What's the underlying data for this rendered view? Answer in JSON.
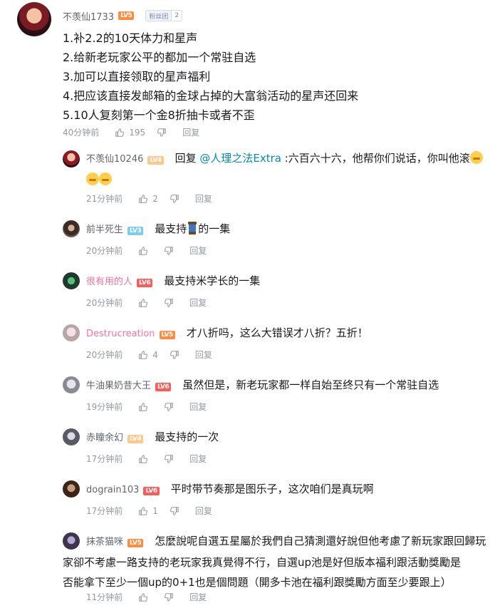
{
  "main_comment": {
    "username": "不羡仙1733",
    "level": "LV5",
    "fan_badge": {
      "label": "粉丝团",
      "level": "2"
    },
    "lines": [
      "1.补2.2的10天体力和星声",
      "2.给新老玩家公平的都加一个常驻自选",
      "3.加可以直接领取的星声福利",
      "4.把应该直接发邮箱的金球占掉的大富翁活动的星声还回来",
      "5.10人复刻第一个金8折抽卡或者不歪"
    ],
    "time": "40分钟前",
    "likes": "195",
    "reply_label": "回复"
  },
  "replies": [
    {
      "username": "不羡仙10246",
      "level": "LV4",
      "pre": "回复 ",
      "mention": "@人理之法Extra",
      "text": " :六百六十六，他帮你们说话，你叫他滚",
      "time": "21分钟前",
      "likes": "2",
      "reply_label": "回复"
    },
    {
      "username": "前半死生",
      "level": "LV3",
      "text_a": "最支持",
      "text_b": "的一集",
      "time": "20分钟前",
      "likes": "",
      "reply_label": "回复"
    },
    {
      "username": "很有用的人",
      "level": "LV6",
      "text": "最支持米学长的一集",
      "time": "20分钟前",
      "likes": "",
      "reply_label": "回复"
    },
    {
      "username": "Destrucreation",
      "level": "LV5",
      "text": "才八折吗，这么大错误才八折？五折！",
      "time": "20分钟前",
      "likes": "4",
      "reply_label": "回复"
    },
    {
      "username": "牛油果奶昔大王",
      "level": "LV6",
      "text": "虽然但是，新老玩家都一样自始至终只有一个常驻自选",
      "time": "19分钟前",
      "likes": "",
      "reply_label": "回复"
    },
    {
      "username": "赤瞳余幻",
      "level": "LV4",
      "text": "最支持的一次",
      "time": "17分钟前",
      "likes": "",
      "reply_label": "回复"
    },
    {
      "username": "dograin103",
      "level": "LV6",
      "text": "平时带节奏那是图乐子，这次咱们是真玩啊",
      "time": "17分钟前",
      "likes": "1",
      "reply_label": "回复"
    },
    {
      "username": "抹茶猫咪",
      "level": "LV5",
      "text_lines": [
        "怎麼說呢自選五星屬於我們自己猜測還好說但他考慮了新玩家跟回歸玩",
        "家卻不考慮一路支持的老玩家我真覺得不行，自選up池是好但版本福利跟活動獎勵是",
        "否能拿下至少一個up的0+1也是個問題（開多卡池在福利跟獎勵方面至少要跟上）"
      ],
      "time": "11分钟前",
      "likes": "",
      "reply_label": "回复"
    }
  ],
  "icons": {
    "like": "thumbs-up-icon",
    "dislike": "thumbs-down-icon"
  }
}
